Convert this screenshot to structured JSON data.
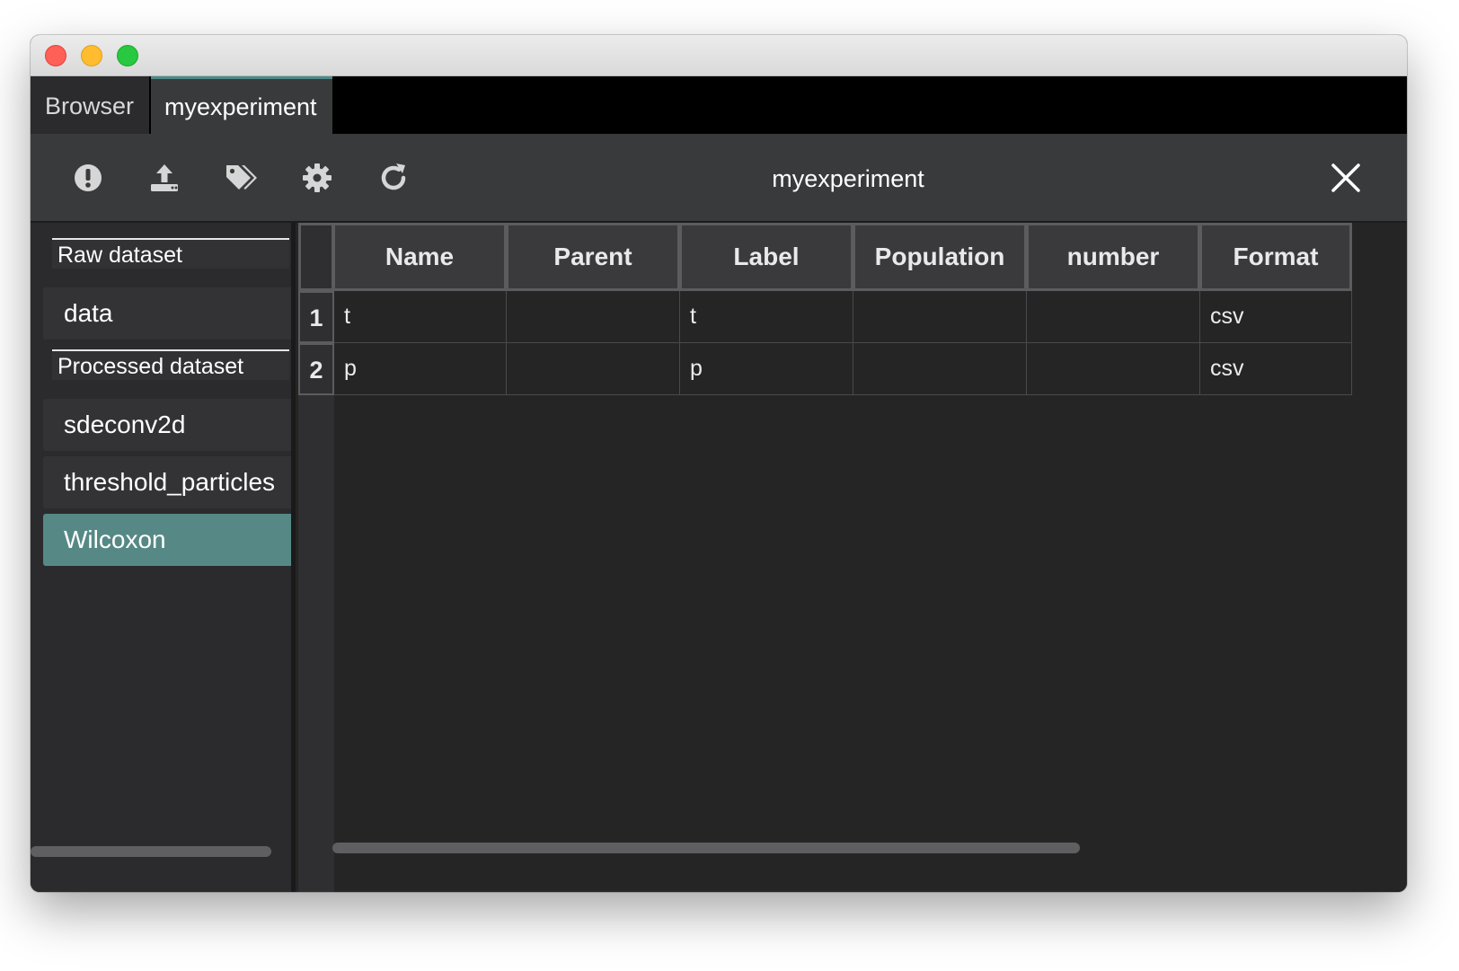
{
  "window": {
    "traffic_lights": [
      "close",
      "minimize",
      "zoom"
    ]
  },
  "tabs": [
    {
      "label": "Browser",
      "active": false
    },
    {
      "label": "myexperiment",
      "active": true
    }
  ],
  "toolbar": {
    "title": "myexperiment",
    "icons": [
      "exclamation-icon",
      "upload-icon",
      "tags-icon",
      "gear-icon",
      "refresh-icon"
    ],
    "close_icon": "close-icon"
  },
  "sidebar": {
    "sections": [
      {
        "header": "Raw dataset",
        "items": [
          {
            "label": "data",
            "selected": false
          }
        ]
      },
      {
        "header": "Processed dataset",
        "items": [
          {
            "label": "sdeconv2d",
            "selected": false
          },
          {
            "label": "threshold_particles",
            "selected": false
          },
          {
            "label": "Wilcoxon",
            "selected": true
          }
        ]
      }
    ]
  },
  "table": {
    "columns": [
      "Name",
      "Parent",
      "Label",
      "Population",
      "number",
      "Format"
    ],
    "rows": [
      {
        "num": "1",
        "cells": [
          "t",
          "",
          "t",
          "",
          "",
          "csv"
        ]
      },
      {
        "num": "2",
        "cells": [
          "p",
          "",
          "p",
          "",
          "",
          "csv"
        ]
      }
    ]
  },
  "colors": {
    "accent": "#568986",
    "background": "#252525",
    "toolbar": "#393a3c",
    "tab_active_border": "#4f8a88"
  }
}
